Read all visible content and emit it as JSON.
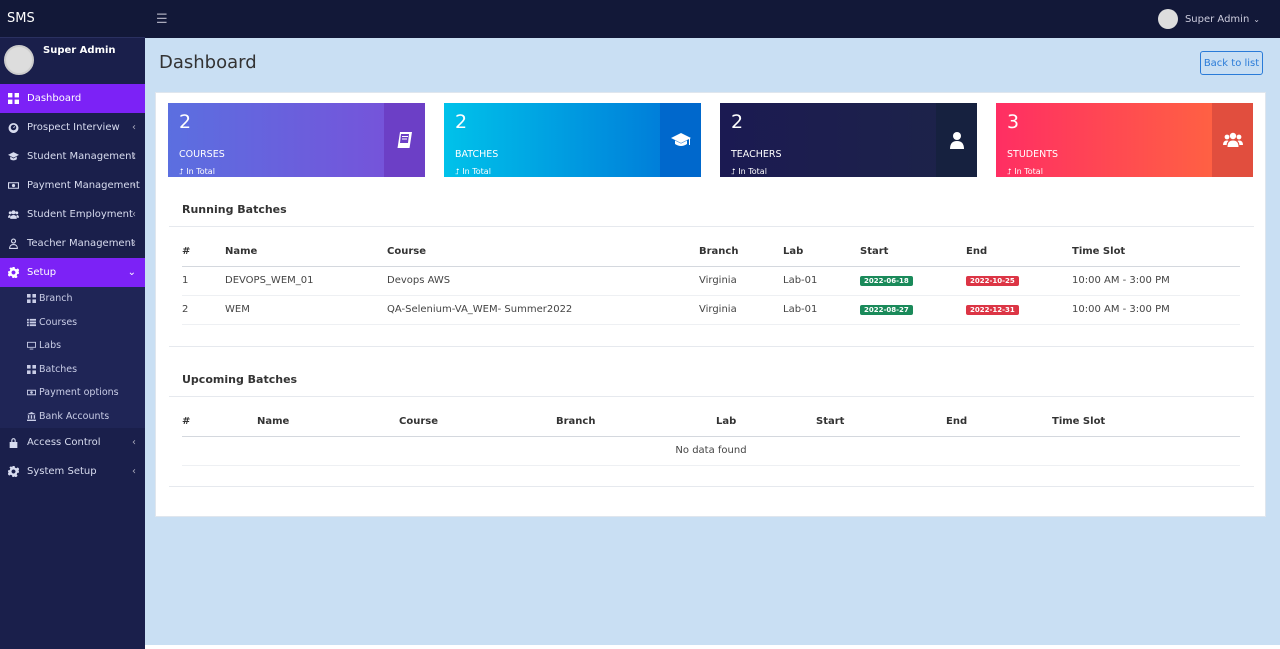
{
  "app": {
    "brand": "SMS",
    "user_name": "Super Admin"
  },
  "sidebar": {
    "items": [
      {
        "label": "Dashboard",
        "icon": "dashboard-icon",
        "active": true,
        "chevron": ""
      },
      {
        "label": "Prospect Interview",
        "icon": "gauge-icon",
        "active": false,
        "chevron": "‹"
      },
      {
        "label": "Student Management",
        "icon": "graduation-cap-icon",
        "active": false,
        "chevron": "‹"
      },
      {
        "label": "Payment Management",
        "icon": "money-icon",
        "active": false,
        "chevron": "‹"
      },
      {
        "label": "Student Employment",
        "icon": "users-icon",
        "active": false,
        "chevron": "‹"
      },
      {
        "label": "Teacher Management",
        "icon": "user-icon",
        "active": false,
        "chevron": "‹"
      },
      {
        "label": "Setup",
        "icon": "gear-icon",
        "active": true,
        "chevron": "⌄"
      }
    ],
    "setup_sub": [
      {
        "label": "Branch",
        "icon": "grid-icon"
      },
      {
        "label": "Courses",
        "icon": "list-icon"
      },
      {
        "label": "Labs",
        "icon": "monitor-icon"
      },
      {
        "label": "Batches",
        "icon": "grid-icon"
      },
      {
        "label": "Payment options",
        "icon": "money-icon"
      },
      {
        "label": "Bank Accounts",
        "icon": "bank-icon"
      }
    ],
    "after_items": [
      {
        "label": "Access Control",
        "icon": "lock-icon",
        "chevron": "‹"
      },
      {
        "label": "System Setup",
        "icon": "gear-icon",
        "chevron": "‹"
      }
    ]
  },
  "topbar": {
    "user_label": "Super Admin"
  },
  "page": {
    "title": "Dashboard",
    "back_label": "Back to list"
  },
  "stats": [
    {
      "value": "2",
      "label": "COURSES",
      "sub": "In Total",
      "color_from": "#5b6fe0",
      "color_to": "#7a4fd9",
      "icon_bg": "#6c3fc6",
      "icon": "book-icon"
    },
    {
      "value": "2",
      "label": "BATCHES",
      "sub": "In Total",
      "color_from": "#00c2ea",
      "color_to": "#0072d6",
      "icon_bg": "#0068cc",
      "icon": "graduation-cap-icon"
    },
    {
      "value": "2",
      "label": "TEACHERS",
      "sub": "In Total",
      "color_from": "#1b1a52",
      "color_to": "#1d2448",
      "icon_bg": "#16213f",
      "icon": "user-icon"
    },
    {
      "value": "3",
      "label": "STUDENTS",
      "sub": "In Total",
      "color_from": "#ff2e63",
      "color_to": "#ff6a3d",
      "icon_bg": "#e14e3e",
      "icon": "users-icon"
    }
  ],
  "running": {
    "title": "Running Batches",
    "headers": [
      "#",
      "Name",
      "Course",
      "Branch",
      "Lab",
      "Start",
      "End",
      "Time Slot"
    ],
    "rows": [
      {
        "num": "1",
        "name": "DEVOPS_WEM_01",
        "course": "Devops AWS",
        "branch": "Virginia",
        "lab": "Lab-01",
        "start": "2022-06-18",
        "end": "2022-10-25",
        "slot": "10:00 AM - 3:00 PM"
      },
      {
        "num": "2",
        "name": "WEM",
        "course": "QA-Selenium-VA_WEM- Summer2022",
        "branch": "Virginia",
        "lab": "Lab-01",
        "start": "2022-08-27",
        "end": "2022-12-31",
        "slot": "10:00 AM - 3:00 PM"
      }
    ]
  },
  "upcoming": {
    "title": "Upcoming Batches",
    "headers": [
      "#",
      "Name",
      "Course",
      "Branch",
      "Lab",
      "Start",
      "End",
      "Time Slot"
    ],
    "empty": "No data found"
  }
}
